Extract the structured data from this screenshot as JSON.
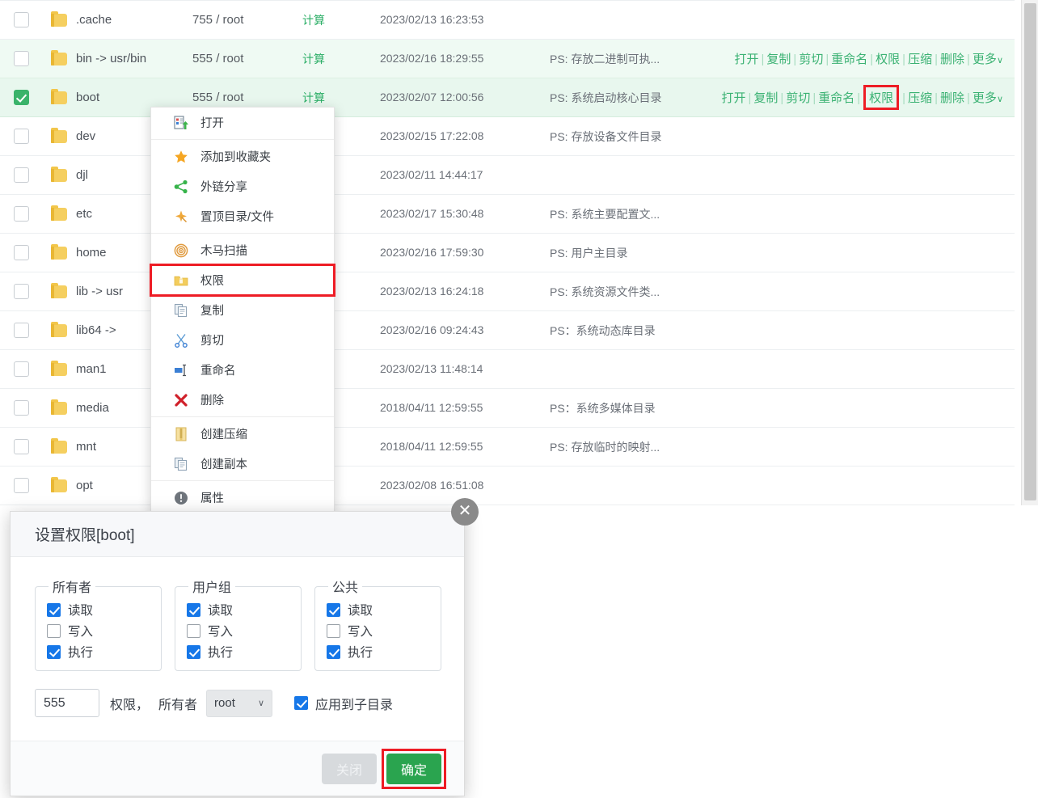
{
  "file_table": {
    "columns": [
      "checkbox",
      "icon",
      "name",
      "permission_owner",
      "size",
      "modified",
      "description",
      "actions"
    ],
    "calc_label": "计算",
    "action_labels": [
      "打开",
      "复制",
      "剪切",
      "重命名",
      "权限",
      "压缩",
      "删除",
      "更多"
    ],
    "more_caret": "∨",
    "separator": "|",
    "rows": [
      {
        "name": ".cache",
        "perm": "755 / root",
        "size": "计算",
        "modified": "2023/02/13 16:23:53",
        "desc": "",
        "checked": false,
        "highlighted": false,
        "selected": false,
        "has_actions": false
      },
      {
        "name": "bin -> usr/bin",
        "perm": "555 / root",
        "size": "计算",
        "modified": "2023/02/16 18:29:55",
        "desc": "PS: 存放二进制可执...",
        "checked": false,
        "highlighted": true,
        "selected": false,
        "has_actions": true
      },
      {
        "name": "boot",
        "perm": "555 / root",
        "size": "计算",
        "modified": "2023/02/07 12:00:56",
        "desc": "PS: 系统启动核心目录",
        "checked": true,
        "highlighted": false,
        "selected": true,
        "has_actions": true
      },
      {
        "name": "dev",
        "perm": "",
        "size": "计算",
        "modified": "2023/02/15 17:22:08",
        "desc": "PS: 存放设备文件目录",
        "checked": false,
        "highlighted": false,
        "selected": false,
        "has_actions": false
      },
      {
        "name": "djl",
        "perm": "",
        "size": "计算",
        "modified": "2023/02/11 14:44:17",
        "desc": "",
        "checked": false,
        "highlighted": false,
        "selected": false,
        "has_actions": false
      },
      {
        "name": "etc",
        "perm": "",
        "size": "计算",
        "modified": "2023/02/17 15:30:48",
        "desc": "PS: 系统主要配置文...",
        "checked": false,
        "highlighted": false,
        "selected": false,
        "has_actions": false
      },
      {
        "name": "home",
        "perm": "",
        "size": "计算",
        "modified": "2023/02/16 17:59:30",
        "desc": "PS: 用户主目录",
        "checked": false,
        "highlighted": false,
        "selected": false,
        "has_actions": false
      },
      {
        "name": "lib -> usr",
        "perm": "",
        "size": "计算",
        "modified": "2023/02/13 16:24:18",
        "desc": "PS: 系统资源文件类...",
        "checked": false,
        "highlighted": false,
        "selected": false,
        "has_actions": false
      },
      {
        "name": "lib64 ->",
        "perm": "",
        "size": "计算",
        "modified": "2023/02/16 09:24:43",
        "desc": "PS：系统动态库目录",
        "checked": false,
        "highlighted": false,
        "selected": false,
        "has_actions": false
      },
      {
        "name": "man1",
        "perm": "",
        "size": "计算",
        "modified": "2023/02/13 11:48:14",
        "desc": "",
        "checked": false,
        "highlighted": false,
        "selected": false,
        "has_actions": false
      },
      {
        "name": "media",
        "perm": "",
        "size": "计算",
        "modified": "2018/04/11 12:59:55",
        "desc": "PS：系统多媒体目录",
        "checked": false,
        "highlighted": false,
        "selected": false,
        "has_actions": false
      },
      {
        "name": "mnt",
        "perm": "",
        "size": "计算",
        "modified": "2018/04/11 12:59:55",
        "desc": "PS: 存放临时的映射...",
        "checked": false,
        "highlighted": false,
        "selected": false,
        "has_actions": false
      },
      {
        "name": "opt",
        "perm": "",
        "size": "计算",
        "modified": "2023/02/08 16:51:08",
        "desc": "",
        "checked": false,
        "highlighted": false,
        "selected": false,
        "has_actions": false
      }
    ]
  },
  "context_menu": {
    "items": [
      {
        "label": "打开",
        "icon": "open-icon",
        "separator_after": true,
        "highlighted": false
      },
      {
        "label": "添加到收藏夹",
        "icon": "star-icon",
        "separator_after": false,
        "highlighted": false
      },
      {
        "label": "外链分享",
        "icon": "share-icon",
        "separator_after": false,
        "highlighted": false
      },
      {
        "label": "置顶目录/文件",
        "icon": "pin-icon",
        "separator_after": true,
        "highlighted": false
      },
      {
        "label": "木马扫描",
        "icon": "scan-icon",
        "separator_after": false,
        "highlighted": false
      },
      {
        "label": "权限",
        "icon": "permission-icon",
        "separator_after": false,
        "highlighted": true
      },
      {
        "label": "复制",
        "icon": "copy-icon",
        "separator_after": false,
        "highlighted": false
      },
      {
        "label": "剪切",
        "icon": "cut-icon",
        "separator_after": false,
        "highlighted": false
      },
      {
        "label": "重命名",
        "icon": "rename-icon",
        "separator_after": false,
        "highlighted": false
      },
      {
        "label": "删除",
        "icon": "delete-icon",
        "separator_after": true,
        "highlighted": false
      },
      {
        "label": "创建压缩",
        "icon": "archive-icon",
        "separator_after": false,
        "highlighted": false
      },
      {
        "label": "创建副本",
        "icon": "duplicate-icon",
        "separator_after": true,
        "highlighted": false
      },
      {
        "label": "属性",
        "icon": "info-icon",
        "separator_after": false,
        "highlighted": false
      }
    ]
  },
  "dialog": {
    "title": "设置权限[boot]",
    "close_glyph": "✕",
    "groups": [
      {
        "legend": "所有者",
        "options": [
          {
            "label": "读取",
            "checked": true
          },
          {
            "label": "写入",
            "checked": false
          },
          {
            "label": "执行",
            "checked": true
          }
        ]
      },
      {
        "legend": "用户组",
        "options": [
          {
            "label": "读取",
            "checked": true
          },
          {
            "label": "写入",
            "checked": false
          },
          {
            "label": "执行",
            "checked": true
          }
        ]
      },
      {
        "legend": "公共",
        "options": [
          {
            "label": "读取",
            "checked": true
          },
          {
            "label": "写入",
            "checked": false
          },
          {
            "label": "执行",
            "checked": true
          }
        ]
      }
    ],
    "perm_value": "555",
    "perm_placeholder": "权限",
    "perm_label": "权限，",
    "owner_label": "所有者",
    "owner_value": "root",
    "owner_caret": "∨",
    "apply_sub_label": "应用到子目录",
    "apply_sub_checked": true,
    "close_button": "关闭",
    "confirm_button": "确定"
  },
  "colors": {
    "accent_green": "#3bb273",
    "selected_row": "#e8f7ee",
    "highlight_red": "#ee1c25",
    "checkbox_blue": "#1677e8",
    "confirm_green": "#2aa44f"
  }
}
